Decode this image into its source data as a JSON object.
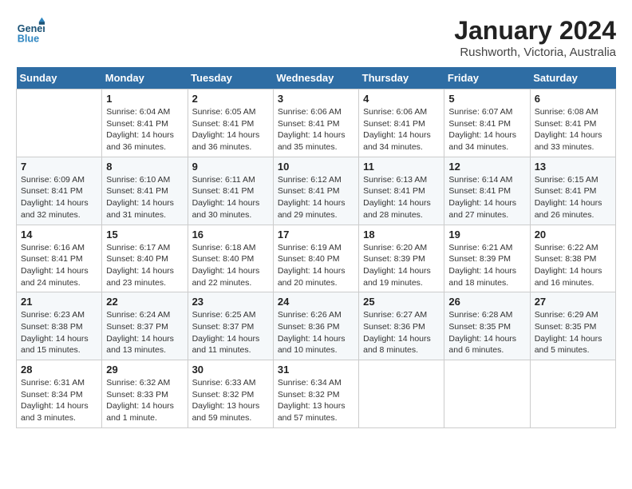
{
  "header": {
    "logo_line1": "General",
    "logo_line2": "Blue",
    "title": "January 2024",
    "subtitle": "Rushworth, Victoria, Australia"
  },
  "weekdays": [
    "Sunday",
    "Monday",
    "Tuesday",
    "Wednesday",
    "Thursday",
    "Friday",
    "Saturday"
  ],
  "weeks": [
    [
      {
        "day": "",
        "info": ""
      },
      {
        "day": "1",
        "info": "Sunrise: 6:04 AM\nSunset: 8:41 PM\nDaylight: 14 hours\nand 36 minutes."
      },
      {
        "day": "2",
        "info": "Sunrise: 6:05 AM\nSunset: 8:41 PM\nDaylight: 14 hours\nand 36 minutes."
      },
      {
        "day": "3",
        "info": "Sunrise: 6:06 AM\nSunset: 8:41 PM\nDaylight: 14 hours\nand 35 minutes."
      },
      {
        "day": "4",
        "info": "Sunrise: 6:06 AM\nSunset: 8:41 PM\nDaylight: 14 hours\nand 34 minutes."
      },
      {
        "day": "5",
        "info": "Sunrise: 6:07 AM\nSunset: 8:41 PM\nDaylight: 14 hours\nand 34 minutes."
      },
      {
        "day": "6",
        "info": "Sunrise: 6:08 AM\nSunset: 8:41 PM\nDaylight: 14 hours\nand 33 minutes."
      }
    ],
    [
      {
        "day": "7",
        "info": "Sunrise: 6:09 AM\nSunset: 8:41 PM\nDaylight: 14 hours\nand 32 minutes."
      },
      {
        "day": "8",
        "info": "Sunrise: 6:10 AM\nSunset: 8:41 PM\nDaylight: 14 hours\nand 31 minutes."
      },
      {
        "day": "9",
        "info": "Sunrise: 6:11 AM\nSunset: 8:41 PM\nDaylight: 14 hours\nand 30 minutes."
      },
      {
        "day": "10",
        "info": "Sunrise: 6:12 AM\nSunset: 8:41 PM\nDaylight: 14 hours\nand 29 minutes."
      },
      {
        "day": "11",
        "info": "Sunrise: 6:13 AM\nSunset: 8:41 PM\nDaylight: 14 hours\nand 28 minutes."
      },
      {
        "day": "12",
        "info": "Sunrise: 6:14 AM\nSunset: 8:41 PM\nDaylight: 14 hours\nand 27 minutes."
      },
      {
        "day": "13",
        "info": "Sunrise: 6:15 AM\nSunset: 8:41 PM\nDaylight: 14 hours\nand 26 minutes."
      }
    ],
    [
      {
        "day": "14",
        "info": "Sunrise: 6:16 AM\nSunset: 8:41 PM\nDaylight: 14 hours\nand 24 minutes."
      },
      {
        "day": "15",
        "info": "Sunrise: 6:17 AM\nSunset: 8:40 PM\nDaylight: 14 hours\nand 23 minutes."
      },
      {
        "day": "16",
        "info": "Sunrise: 6:18 AM\nSunset: 8:40 PM\nDaylight: 14 hours\nand 22 minutes."
      },
      {
        "day": "17",
        "info": "Sunrise: 6:19 AM\nSunset: 8:40 PM\nDaylight: 14 hours\nand 20 minutes."
      },
      {
        "day": "18",
        "info": "Sunrise: 6:20 AM\nSunset: 8:39 PM\nDaylight: 14 hours\nand 19 minutes."
      },
      {
        "day": "19",
        "info": "Sunrise: 6:21 AM\nSunset: 8:39 PM\nDaylight: 14 hours\nand 18 minutes."
      },
      {
        "day": "20",
        "info": "Sunrise: 6:22 AM\nSunset: 8:38 PM\nDaylight: 14 hours\nand 16 minutes."
      }
    ],
    [
      {
        "day": "21",
        "info": "Sunrise: 6:23 AM\nSunset: 8:38 PM\nDaylight: 14 hours\nand 15 minutes."
      },
      {
        "day": "22",
        "info": "Sunrise: 6:24 AM\nSunset: 8:37 PM\nDaylight: 14 hours\nand 13 minutes."
      },
      {
        "day": "23",
        "info": "Sunrise: 6:25 AM\nSunset: 8:37 PM\nDaylight: 14 hours\nand 11 minutes."
      },
      {
        "day": "24",
        "info": "Sunrise: 6:26 AM\nSunset: 8:36 PM\nDaylight: 14 hours\nand 10 minutes."
      },
      {
        "day": "25",
        "info": "Sunrise: 6:27 AM\nSunset: 8:36 PM\nDaylight: 14 hours\nand 8 minutes."
      },
      {
        "day": "26",
        "info": "Sunrise: 6:28 AM\nSunset: 8:35 PM\nDaylight: 14 hours\nand 6 minutes."
      },
      {
        "day": "27",
        "info": "Sunrise: 6:29 AM\nSunset: 8:35 PM\nDaylight: 14 hours\nand 5 minutes."
      }
    ],
    [
      {
        "day": "28",
        "info": "Sunrise: 6:31 AM\nSunset: 8:34 PM\nDaylight: 14 hours\nand 3 minutes."
      },
      {
        "day": "29",
        "info": "Sunrise: 6:32 AM\nSunset: 8:33 PM\nDaylight: 14 hours\nand 1 minute."
      },
      {
        "day": "30",
        "info": "Sunrise: 6:33 AM\nSunset: 8:32 PM\nDaylight: 13 hours\nand 59 minutes."
      },
      {
        "day": "31",
        "info": "Sunrise: 6:34 AM\nSunset: 8:32 PM\nDaylight: 13 hours\nand 57 minutes."
      },
      {
        "day": "",
        "info": ""
      },
      {
        "day": "",
        "info": ""
      },
      {
        "day": "",
        "info": ""
      }
    ]
  ]
}
